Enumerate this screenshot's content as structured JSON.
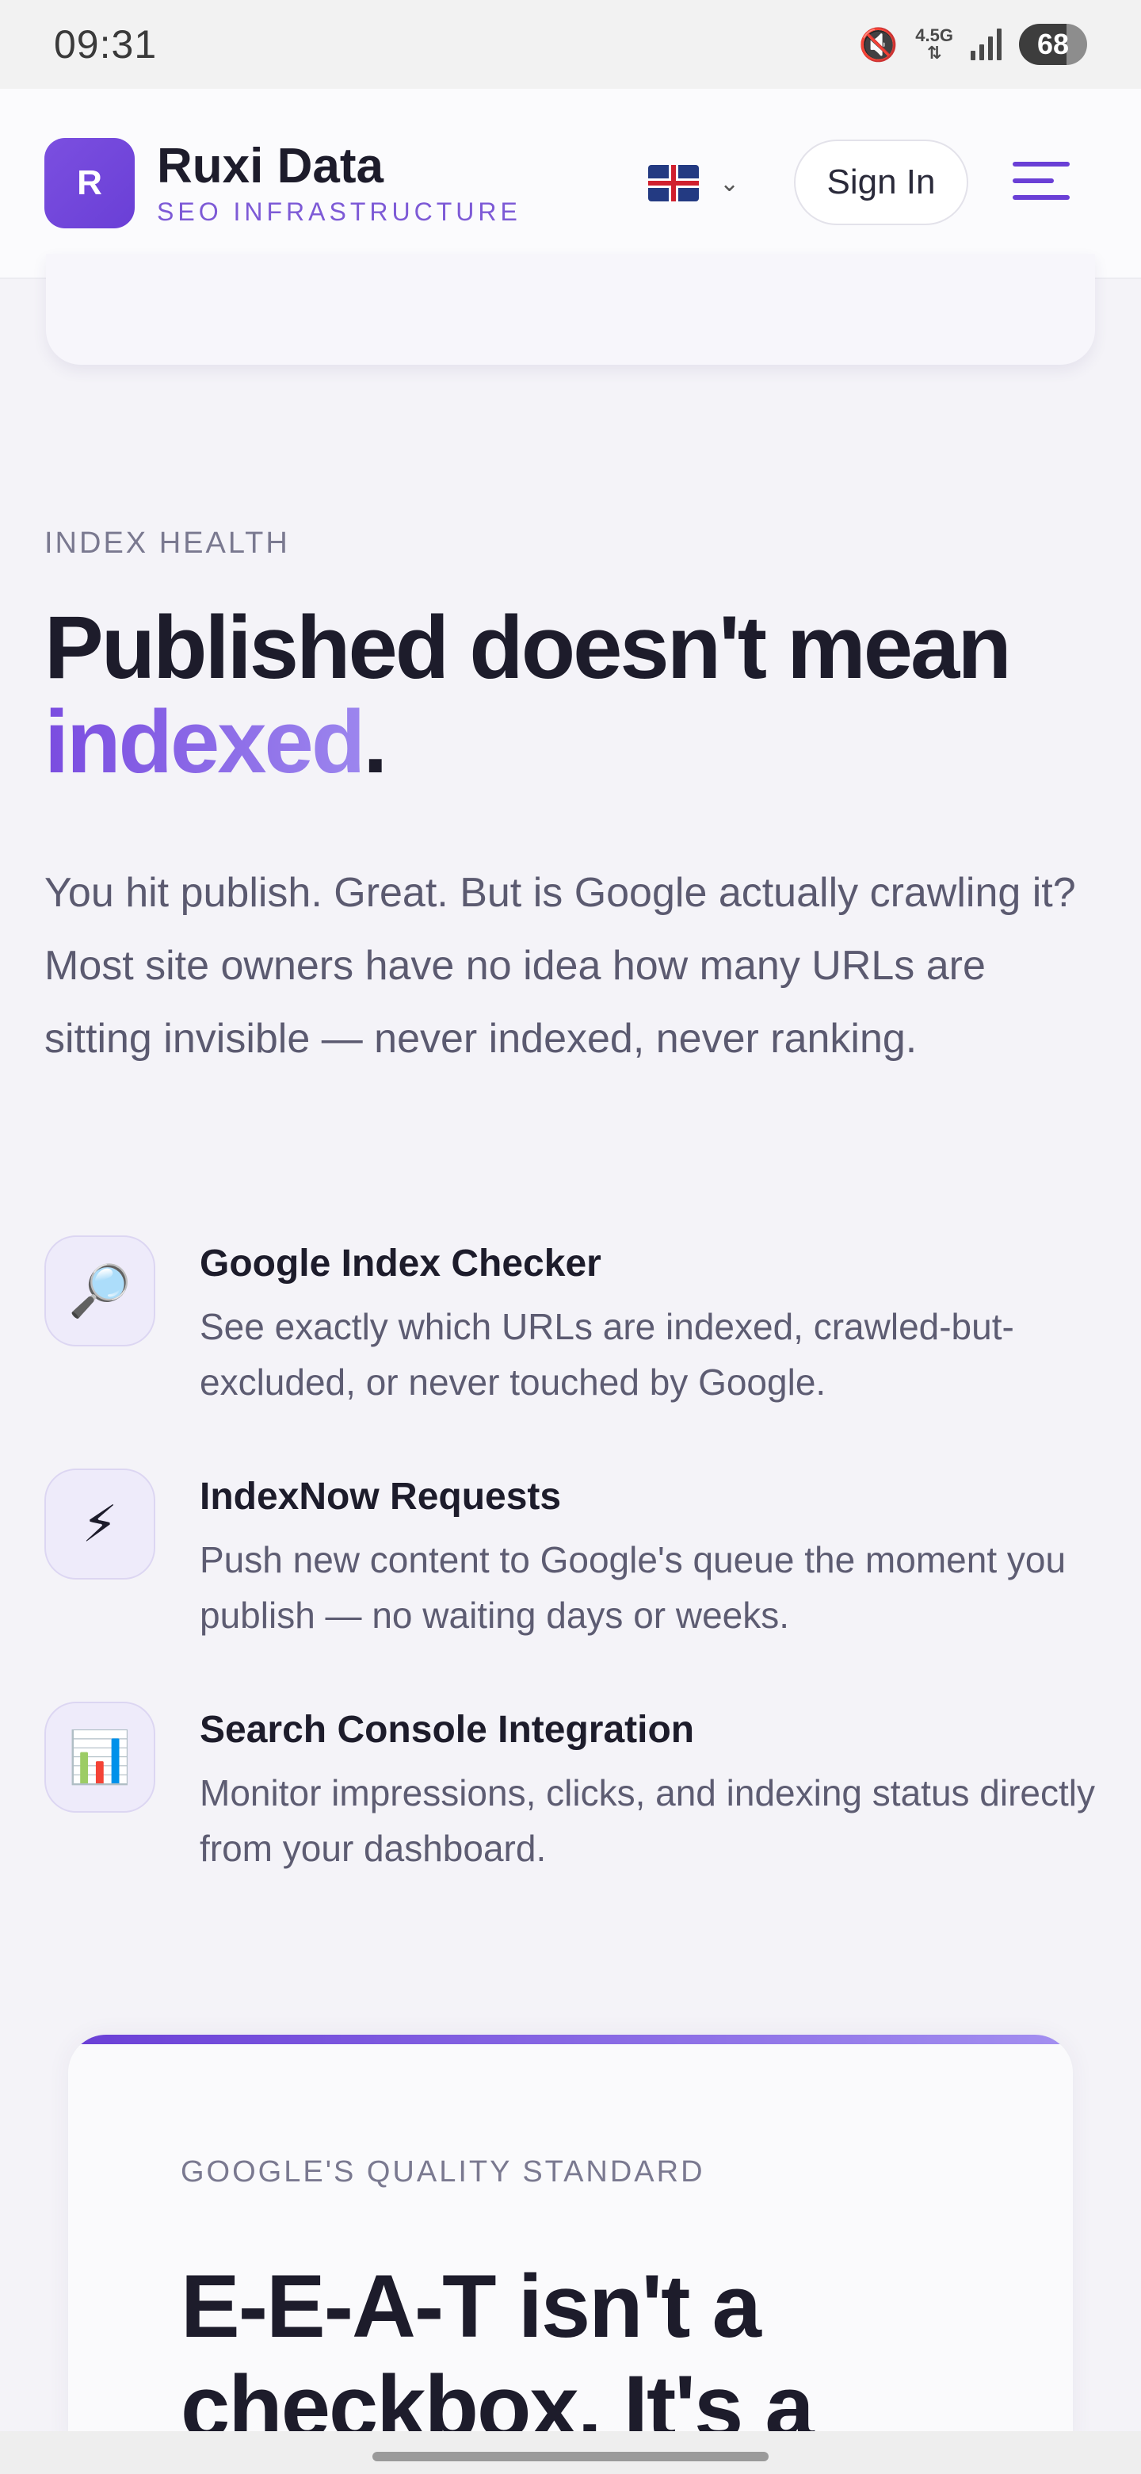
{
  "status_bar": {
    "time": "09:31",
    "network": "4.5G",
    "battery": "68",
    "icons": [
      "mute-icon",
      "network-icon",
      "signal-icon",
      "battery-icon"
    ]
  },
  "header": {
    "logo_letter": "R",
    "brand_name": "Ruxi Data",
    "brand_tagline": "SEO INFRASTRUCTURE",
    "language_flag": "uk-flag-icon",
    "sign_in_label": "Sign In",
    "accent_color": "#6a3fd6"
  },
  "section": {
    "eyebrow": "INDEX HEALTH",
    "headline_part1": "Published doesn't mean",
    "headline_accent": "indexed",
    "headline_end": ".",
    "lead": "You hit publish. Great. But is Google actually crawling it? Most site owners have no idea how many URLs are sitting invisible — never indexed, never ranking."
  },
  "features": [
    {
      "icon": "🔎",
      "icon_name": "magnifier-icon",
      "title": "Google Index Checker",
      "description": "See exactly which URLs are indexed, crawled-but-excluded, or never touched by Google."
    },
    {
      "icon": "⚡",
      "icon_name": "lightning-icon",
      "title": "IndexNow Requests",
      "description": "Push new content to Google's queue the moment you publish — no waiting days or weeks."
    },
    {
      "icon": "📊",
      "icon_name": "bar-chart-icon",
      "title": "Search Console Integration",
      "description": "Monitor impressions, clicks, and indexing status directly from your dashboard."
    }
  ],
  "eeat": {
    "eyebrow": "GOOGLE'S QUALITY STANDARD",
    "headline": "E-E-A-T isn't a checkbox. It's a"
  }
}
